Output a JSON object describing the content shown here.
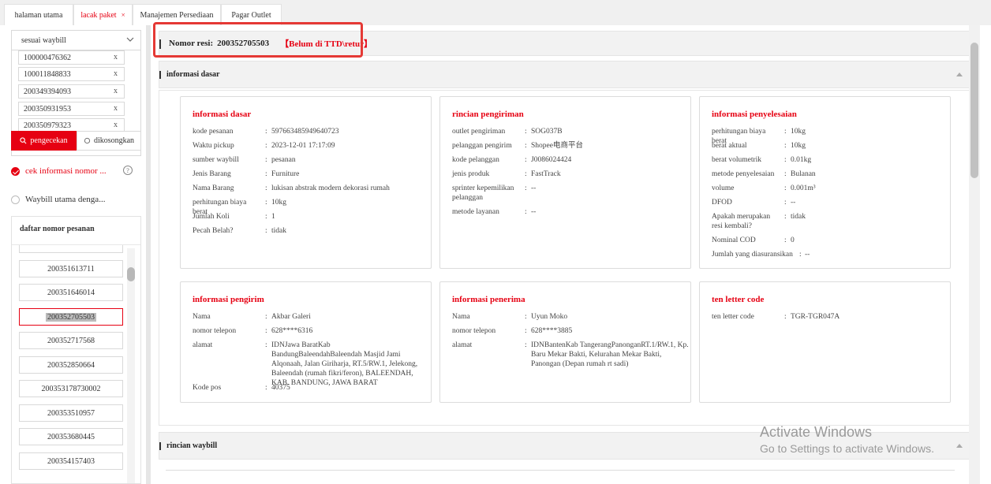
{
  "tabs": [
    {
      "label": "halaman utama",
      "active": false,
      "closable": false
    },
    {
      "label": "lacak paket",
      "active": true,
      "closable": true
    },
    {
      "label": "Manajemen Persediaan",
      "active": false,
      "closable": false
    },
    {
      "label": "Pagar Outlet",
      "active": false,
      "closable": false
    }
  ],
  "sidebar": {
    "select_value": "sesuai waybill",
    "waybills": [
      "100000476362",
      "100011848833",
      "200349394093",
      "200350931953",
      "200350979323"
    ],
    "remove_glyph": "x",
    "check_button": "pengecekan",
    "clear_button": "dikosongkan",
    "option_check": "cek informasi nomor ...",
    "option_main": "Waybill utama denga...",
    "help_glyph": "?",
    "order_title": "daftar nomor pesanan",
    "orders": [
      "200351613711",
      "200351646014",
      "200352705503",
      "200352717568",
      "200352850664",
      "200353178730002",
      "200353510957",
      "200353680445",
      "200354157403"
    ],
    "selected_order": "200352705503"
  },
  "main": {
    "resi_label": "Nomor resi:",
    "resi_number": "200352705503",
    "resi_status": "【Belum di TTD\\retur】",
    "section_basic": "informasi dasar",
    "section_waybill": "rincian waybill",
    "cards": {
      "basic": {
        "title": "informasi dasar",
        "rows": [
          {
            "k": "kode pesanan",
            "v": "597663485949640723"
          },
          {
            "k": "Waktu pickup",
            "v": "2023-12-01 17:17:09"
          },
          {
            "k": "sumber waybill",
            "v": "pesanan"
          },
          {
            "k": "Jenis Barang",
            "v": "Furniture"
          },
          {
            "k": "Nama Barang",
            "v": "lukisan abstrak modern dekorasi rumah"
          },
          {
            "k": "perhitungan biaya berat",
            "v": "10kg"
          },
          {
            "k": "Jumlah Koli",
            "v": "1"
          },
          {
            "k": "Pecah Belah?",
            "v": "tidak"
          }
        ]
      },
      "shipping": {
        "title": "rincian pengiriman",
        "rows": [
          {
            "k": "outlet pengiriman",
            "v": "SOG037B"
          },
          {
            "k": "pelanggan pengirim",
            "v": "Shopee电商平台"
          },
          {
            "k": "kode pelanggan",
            "v": "J0086024424"
          },
          {
            "k": "jenis produk",
            "v": "FastTrack"
          },
          {
            "k": "sprinter kepemilikan pelanggan",
            "v": "--"
          },
          {
            "k": "metode layanan",
            "v": "--"
          }
        ]
      },
      "settlement": {
        "title": "informasi penyelesaian",
        "rows": [
          {
            "k": "perhitungan biaya berat",
            "v": "10kg"
          },
          {
            "k": "berat aktual",
            "v": "10kg"
          },
          {
            "k": "berat volumetrik",
            "v": "0.01kg"
          },
          {
            "k": "metode penyelesaian",
            "v": "Bulanan"
          },
          {
            "k": "volume",
            "v": "0.001m³"
          },
          {
            "k": "DFOD",
            "v": "--"
          },
          {
            "k": "Apakah merupakan resi kembali?",
            "v": "tidak"
          },
          {
            "k": "Nominal COD",
            "v": "0"
          },
          {
            "k": "Jumlah yang diasuransikan",
            "v": "--"
          }
        ]
      },
      "sender": {
        "title": "informasi pengirim",
        "rows": [
          {
            "k": "Nama",
            "v": "Akbar Galeri"
          },
          {
            "k": "nomor telepon",
            "v": "628****6316"
          },
          {
            "k": "alamat",
            "v": "IDNJawa BaratKab BandungBaleendahBaleendah Masjid Jami Alqonaah, Jalan Giriharja, RT.5/RW.1, Jelekong, Baleendah (rumah fikri/feron), BALEENDAH, KAB. BANDUNG, JAWA BARAT"
          },
          {
            "k": "Kode pos",
            "v": "40375"
          }
        ]
      },
      "receiver": {
        "title": "informasi penerima",
        "rows": [
          {
            "k": "Nama",
            "v": "Uyun Moko"
          },
          {
            "k": "nomor telepon",
            "v": "628****3885"
          },
          {
            "k": "alamat",
            "v": "IDNBantenKab TangerangPanonganRT.1/RW.1, Kp. Baru Mekar Bakti, Kelurahan Mekar Bakti, Panongan (Depan rumah rt sadi)"
          }
        ]
      },
      "tenletter": {
        "title": "ten letter code",
        "rows": [
          {
            "k": "ten letter code",
            "v": "TGR-TGR047A"
          }
        ]
      }
    }
  },
  "overlay": {
    "activate_title": "Activate Windows",
    "activate_sub": "Go to Settings to activate Windows."
  },
  "colors": {
    "accent": "#e60012",
    "highlight_box": "#e53935"
  }
}
